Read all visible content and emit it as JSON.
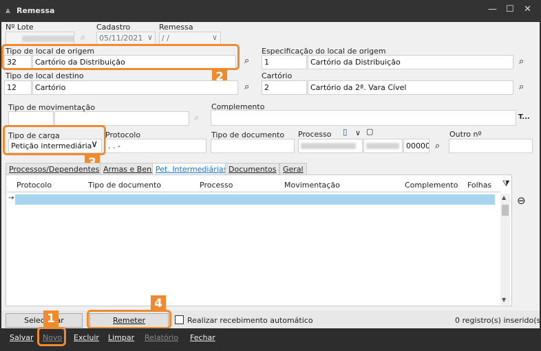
{
  "window": {
    "title": "Remessa"
  },
  "row1": {
    "lote_label": "Nº Lote",
    "cadastro_label": "Cadastro",
    "cadastro_value": "05/11/2021",
    "remessa_label": "Remessa",
    "remessa_value": " /  /"
  },
  "origem": {
    "tipo_label": "Tipo de local de origem",
    "tipo_code": "32",
    "tipo_name": "Cartório da Distribuição",
    "espec_label": "Especificação do local de origem",
    "espec_code": "1",
    "espec_name": "Cartório da Distribuição"
  },
  "destino": {
    "tipo_label": "Tipo de local destino",
    "tipo_code": "12",
    "tipo_name": "Cartório",
    "cartorio_label": "Cartório",
    "cartorio_code": "2",
    "cartorio_name": "Cartório da 2ª. Vara Cível"
  },
  "mov": {
    "tipo_label": "Tipo de movimentação",
    "complemento_label": "Complemento",
    "complemento_btn": "T..."
  },
  "carga": {
    "tipo_label": "Tipo de carga",
    "tipo_value": "Petição intermediária",
    "protocolo_label": "Protocolo",
    "protocolo_value": ".   .      -",
    "tipodoc_label": "Tipo de documento",
    "processo_label": "Processo",
    "processo_suffix": "00000",
    "outro_label": "Outro nº"
  },
  "tabs": [
    {
      "label": "Processos/Dependentes"
    },
    {
      "label": "Armas e Bens"
    },
    {
      "label": "Pet. Intermediárias"
    },
    {
      "label": "Documentos"
    },
    {
      "label": "Geral"
    }
  ],
  "grid": {
    "columns": [
      "Protocolo",
      "Tipo de documento",
      "Processo",
      "Movimentação",
      "Complemento",
      "Folhas"
    ],
    "row_marker": "→"
  },
  "bottom": {
    "selecionar_label": "Selecionar",
    "remeter_label": "Remeter",
    "auto_label": "Realizar recebimento automático",
    "count_text": "0 registro(s) inserido(s)"
  },
  "menu": {
    "salvar": "Salvar",
    "novo": "Novo",
    "excluir": "Excluir",
    "limpar": "Limpar",
    "relatorio": "Relatório",
    "fechar": "Fechar"
  },
  "badges": {
    "b1": "1",
    "b2": "2",
    "b3": "3",
    "b4": "4"
  },
  "icons": {
    "search": "⌕",
    "funnel": "⧩",
    "remove": "⊖",
    "chevron": "∨",
    "minimize": "—",
    "maximize": "☐",
    "close": "✕",
    "logo": "⩓"
  },
  "colors": {
    "highlight": "#ee8a2f",
    "active_tab": "#1a73c9",
    "selection": "#a8d4f0"
  }
}
